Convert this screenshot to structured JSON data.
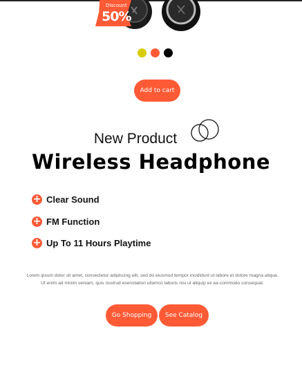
{
  "product": {
    "discount_label": "Discount",
    "discount_value": "50%"
  },
  "colors": {
    "accent": "#ff5a36",
    "swatches": [
      "#d8cc00",
      "#ff5a36",
      "#000000"
    ]
  },
  "buttons": {
    "add_to_cart": "Add to cart",
    "go_shopping": "Go Shopping",
    "see_catalog": "See Catalog"
  },
  "hero": {
    "subtitle": "New Product",
    "title": "Wireless Headphone"
  },
  "features": [
    {
      "icon": "plus-circle-icon",
      "label": "Clear Sound"
    },
    {
      "icon": "plus-circle-icon",
      "label": "FM Function"
    },
    {
      "icon": "plus-circle-icon",
      "label": "Up To 11 Hours Playtime"
    }
  ],
  "description": {
    "line1": "Lorem ipsum dolor sit amet, consectetur adipiscing elit, sed do eiusmod tempor incididunt ut labore et dolore magna aliqua.",
    "line2": "Ut enim ad minim veniam, quis nostrud exercitation ullamco laboris nisi ut aliquip ex ea commodo consequat."
  }
}
